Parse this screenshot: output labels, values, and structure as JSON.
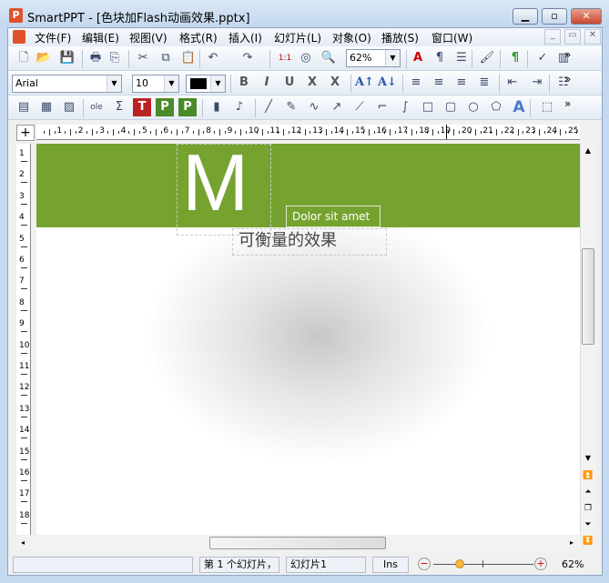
{
  "window": {
    "title": "SmartPPT - [色块加Flash动画效果.pptx]",
    "app_icon": "P",
    "minimize": "▁",
    "maximize": "▫",
    "close": "✕"
  },
  "menu": {
    "items": [
      "文件(F)",
      "编辑(E)",
      "视图(V)",
      "格式(R)",
      "插入(I)",
      "幻灯片(L)",
      "对象(O)",
      "播放(S)",
      "窗口(W)"
    ],
    "doc_min": "_",
    "doc_restore": "▭",
    "doc_close": "✕"
  },
  "toolbar1": {
    "zoom": "62%",
    "icons": [
      "new-icon",
      "open-icon",
      "save-icon",
      "print-icon",
      "pdf-icon",
      "cut-icon",
      "copy-icon",
      "paste-icon",
      "undo-icon",
      "redo-icon",
      "actual-size-icon",
      "zoom-region-icon",
      "zoom-icon",
      "text-color-icon",
      "paragraph-icon",
      "list-icon",
      "brush-icon",
      "pilcrow-icon",
      "spellcheck-icon",
      "chart-icon"
    ]
  },
  "toolbar2": {
    "font": "Arial",
    "size": "10",
    "color": "#000000",
    "icons": [
      "bold-icon",
      "italic-icon",
      "underline-icon",
      "strike-icon",
      "clear-format-icon",
      "grow-font-icon",
      "shrink-font-icon",
      "align-left-icon",
      "align-center-icon",
      "align-right-icon",
      "justify-icon",
      "outdent-icon",
      "indent-icon",
      "bullets-icon"
    ]
  },
  "toolbar3": {
    "icons": [
      "textbox-icon",
      "table-icon",
      "image-icon",
      "ole-icon",
      "formula-icon",
      "text-frame-icon",
      "p-frame-icon",
      "p-frame2-icon",
      "video-icon",
      "audio-icon",
      "line-icon",
      "pen-icon",
      "curve-icon",
      "arrow-icon",
      "connector-icon",
      "elbow-connector-icon",
      "curved-connector-icon",
      "rectangle-icon",
      "rounded-rect-icon",
      "ellipse-icon",
      "shapes-icon",
      "wordart-icon",
      "group-icon"
    ]
  },
  "more": "»",
  "ruler": {
    "h": [
      "1",
      "2",
      "3",
      "4",
      "5",
      "6",
      "7",
      "8",
      "9",
      "10",
      "11",
      "12",
      "13",
      "14",
      "15",
      "16",
      "17",
      "18",
      "19",
      "20",
      "21",
      "22",
      "23",
      "24",
      "25"
    ],
    "v": [
      "1",
      "2",
      "3",
      "4",
      "5",
      "6",
      "7",
      "8",
      "9",
      "10",
      "11",
      "12",
      "13",
      "14",
      "15",
      "16",
      "17",
      "18"
    ]
  },
  "slide": {
    "big_letter": "M",
    "caption": "Dolor sit amet",
    "heading": "可衡量的效果",
    "band_color": "#76a22f"
  },
  "status": {
    "slide_pos": "第 1 个幻灯片，",
    "slide_name": "幻灯片1",
    "mode": "Ins",
    "zoom": "62%",
    "zoom_level_percent": 62
  }
}
